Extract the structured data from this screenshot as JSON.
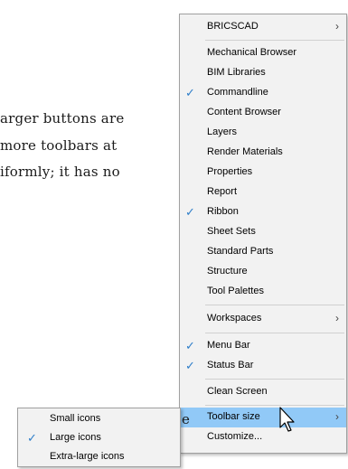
{
  "document": {
    "lines": [
      "arger buttons are",
      "more toolbars at",
      "iformly; it has no"
    ],
    "stray_char": "e"
  },
  "menu": {
    "items": [
      {
        "label": "BRICSCAD",
        "checked": false,
        "submenu": true
      },
      {
        "label": "Mechanical Browser",
        "checked": false,
        "submenu": false
      },
      {
        "label": "BIM Libraries",
        "checked": false,
        "submenu": false
      },
      {
        "label": "Commandline",
        "checked": true,
        "submenu": false
      },
      {
        "label": "Content Browser",
        "checked": false,
        "submenu": false
      },
      {
        "label": "Layers",
        "checked": false,
        "submenu": false
      },
      {
        "label": "Render Materials",
        "checked": false,
        "submenu": false
      },
      {
        "label": "Properties",
        "checked": false,
        "submenu": false
      },
      {
        "label": "Report",
        "checked": false,
        "submenu": false
      },
      {
        "label": "Ribbon",
        "checked": true,
        "submenu": false
      },
      {
        "label": "Sheet Sets",
        "checked": false,
        "submenu": false
      },
      {
        "label": "Standard Parts",
        "checked": false,
        "submenu": false
      },
      {
        "label": "Structure",
        "checked": false,
        "submenu": false
      },
      {
        "label": "Tool Palettes",
        "checked": false,
        "submenu": false
      },
      {
        "label": "Workspaces",
        "checked": false,
        "submenu": true
      },
      {
        "label": "Menu Bar",
        "checked": true,
        "submenu": false
      },
      {
        "label": "Status Bar",
        "checked": true,
        "submenu": false
      },
      {
        "label": "Clean Screen",
        "checked": false,
        "submenu": false
      },
      {
        "label": "Toolbar size",
        "checked": false,
        "submenu": true,
        "highlighted": true
      },
      {
        "label": "Customize...",
        "checked": false,
        "submenu": false
      }
    ]
  },
  "submenu": {
    "items": [
      {
        "label": "Small icons",
        "checked": false
      },
      {
        "label": "Large icons",
        "checked": true
      },
      {
        "label": "Extra-large icons",
        "checked": false
      }
    ]
  },
  "glyphs": {
    "check": "✓",
    "arrow": "›"
  },
  "colors": {
    "highlight": "#91c9f7",
    "check": "#2e7ec9"
  }
}
